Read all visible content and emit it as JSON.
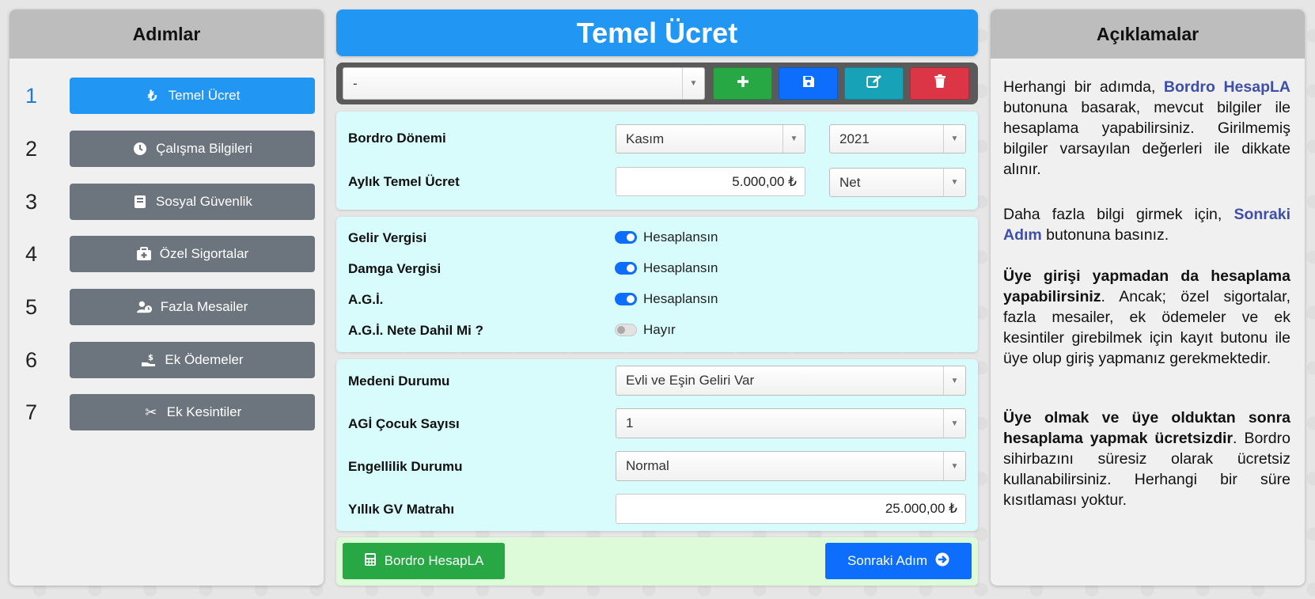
{
  "left_panel": {
    "title": "Adımlar",
    "steps": [
      {
        "num": "1",
        "label": "Temel Ücret",
        "icon": "lira-icon"
      },
      {
        "num": "2",
        "label": "Çalışma Bilgileri",
        "icon": "clock-icon"
      },
      {
        "num": "3",
        "label": "Sosyal Güvenlik",
        "icon": "book-icon"
      },
      {
        "num": "4",
        "label": "Özel Sigortalar",
        "icon": "medkit-icon"
      },
      {
        "num": "5",
        "label": "Fazla Mesailer",
        "icon": "user-clock-icon"
      },
      {
        "num": "6",
        "label": "Ek Ödemeler",
        "icon": "hand-holding-money-icon"
      },
      {
        "num": "7",
        "label": "Ek Kesintiler",
        "icon": "scissors-icon"
      }
    ]
  },
  "center": {
    "title": "Temel Ücret",
    "record_select": "-",
    "toolbar_colors": {
      "add": "#28a745",
      "save": "#0d6efd",
      "edit": "#17a2b8",
      "delete": "#dc3545"
    },
    "period": {
      "label": "Bordro Dönemi",
      "month": "Kasım",
      "year": "2021"
    },
    "salary": {
      "label": "Aylık Temel Ücret",
      "value": "5.000,00 ₺",
      "type": "Net"
    },
    "taxes": [
      {
        "label": "Gelir Vergisi",
        "status": "Hesaplansın",
        "on": true
      },
      {
        "label": "Damga Vergisi",
        "status": "Hesaplansın",
        "on": true
      },
      {
        "label": "A.G.İ.",
        "status": "Hesaplansın",
        "on": true
      },
      {
        "label": "A.G.İ. Nete Dahil Mi ?",
        "status": "Hayır",
        "on": false
      }
    ],
    "marital": {
      "label": "Medeni Durumu",
      "value": "Evli ve Eşin Geliri Var"
    },
    "children": {
      "label": "AGİ Çocuk Sayısı",
      "value": "1"
    },
    "disability": {
      "label": "Engellilik Durumu",
      "value": "Normal"
    },
    "annual_base": {
      "label": "Yıllık GV Matrahı",
      "value": "25.000,00 ₺"
    },
    "calc_button": "Bordro HesapLA",
    "next_button": "Sonraki Adım"
  },
  "right_panel": {
    "title": "Açıklamalar",
    "p1_a": "Herhangi bir adımda, ",
    "p1_hl": "Bordro HesapLA",
    "p1_b": " butonuna basarak, mevcut bilgiler ile hesaplama yapabilirsiniz. Girilmemiş bilgiler varsayılan değerleri ile dikkate alınır.",
    "p2_a": "Daha fazla bilgi girmek için, ",
    "p2_hl": "Sonraki Adım",
    "p2_b": " butonuna basınız.",
    "p3_bold": "Üye girişi yapmadan da hesaplama yapabilirsiniz",
    "p3_b": ". Ancak; özel sigortalar, fazla mesailer, ek ödemeler ve ek kesintiler girebilmek için kayıt butonu ile üye olup giriş yapmanız gerekmektedir.",
    "p4_bold": "Üye olmak ve üye olduktan sonra hesaplama yapmak ücretsizdir",
    "p4_b": ". Bordro sihirbazını süresiz olarak ücretsiz kullanabilirsiniz. Herhangi bir süre kısıtlaması yoktur."
  }
}
